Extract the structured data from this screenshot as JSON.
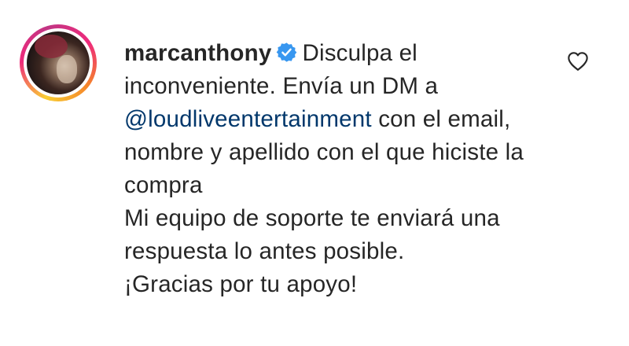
{
  "comment": {
    "username": "marcanthony",
    "verified_icon": "verified-badge-icon",
    "verified_color": "#3897f0",
    "text_before_mention": "Disculpa el inconveniente. Envía un DM a",
    "mention": "@loudliveentertainment",
    "text_after_mention": "con el email, nombre y apellido con el que hiciste la compra",
    "line_support": "Mi equipo de soporte te enviará una respuesta lo antes posible.",
    "line_thanks": "¡Gracias por tu apoyo!",
    "like_icon": "heart-icon",
    "mention_color": "#00376b",
    "story_ring_colors": [
      "#f9ce34",
      "#ee2a7b",
      "#c13584",
      "#f58529"
    ]
  }
}
